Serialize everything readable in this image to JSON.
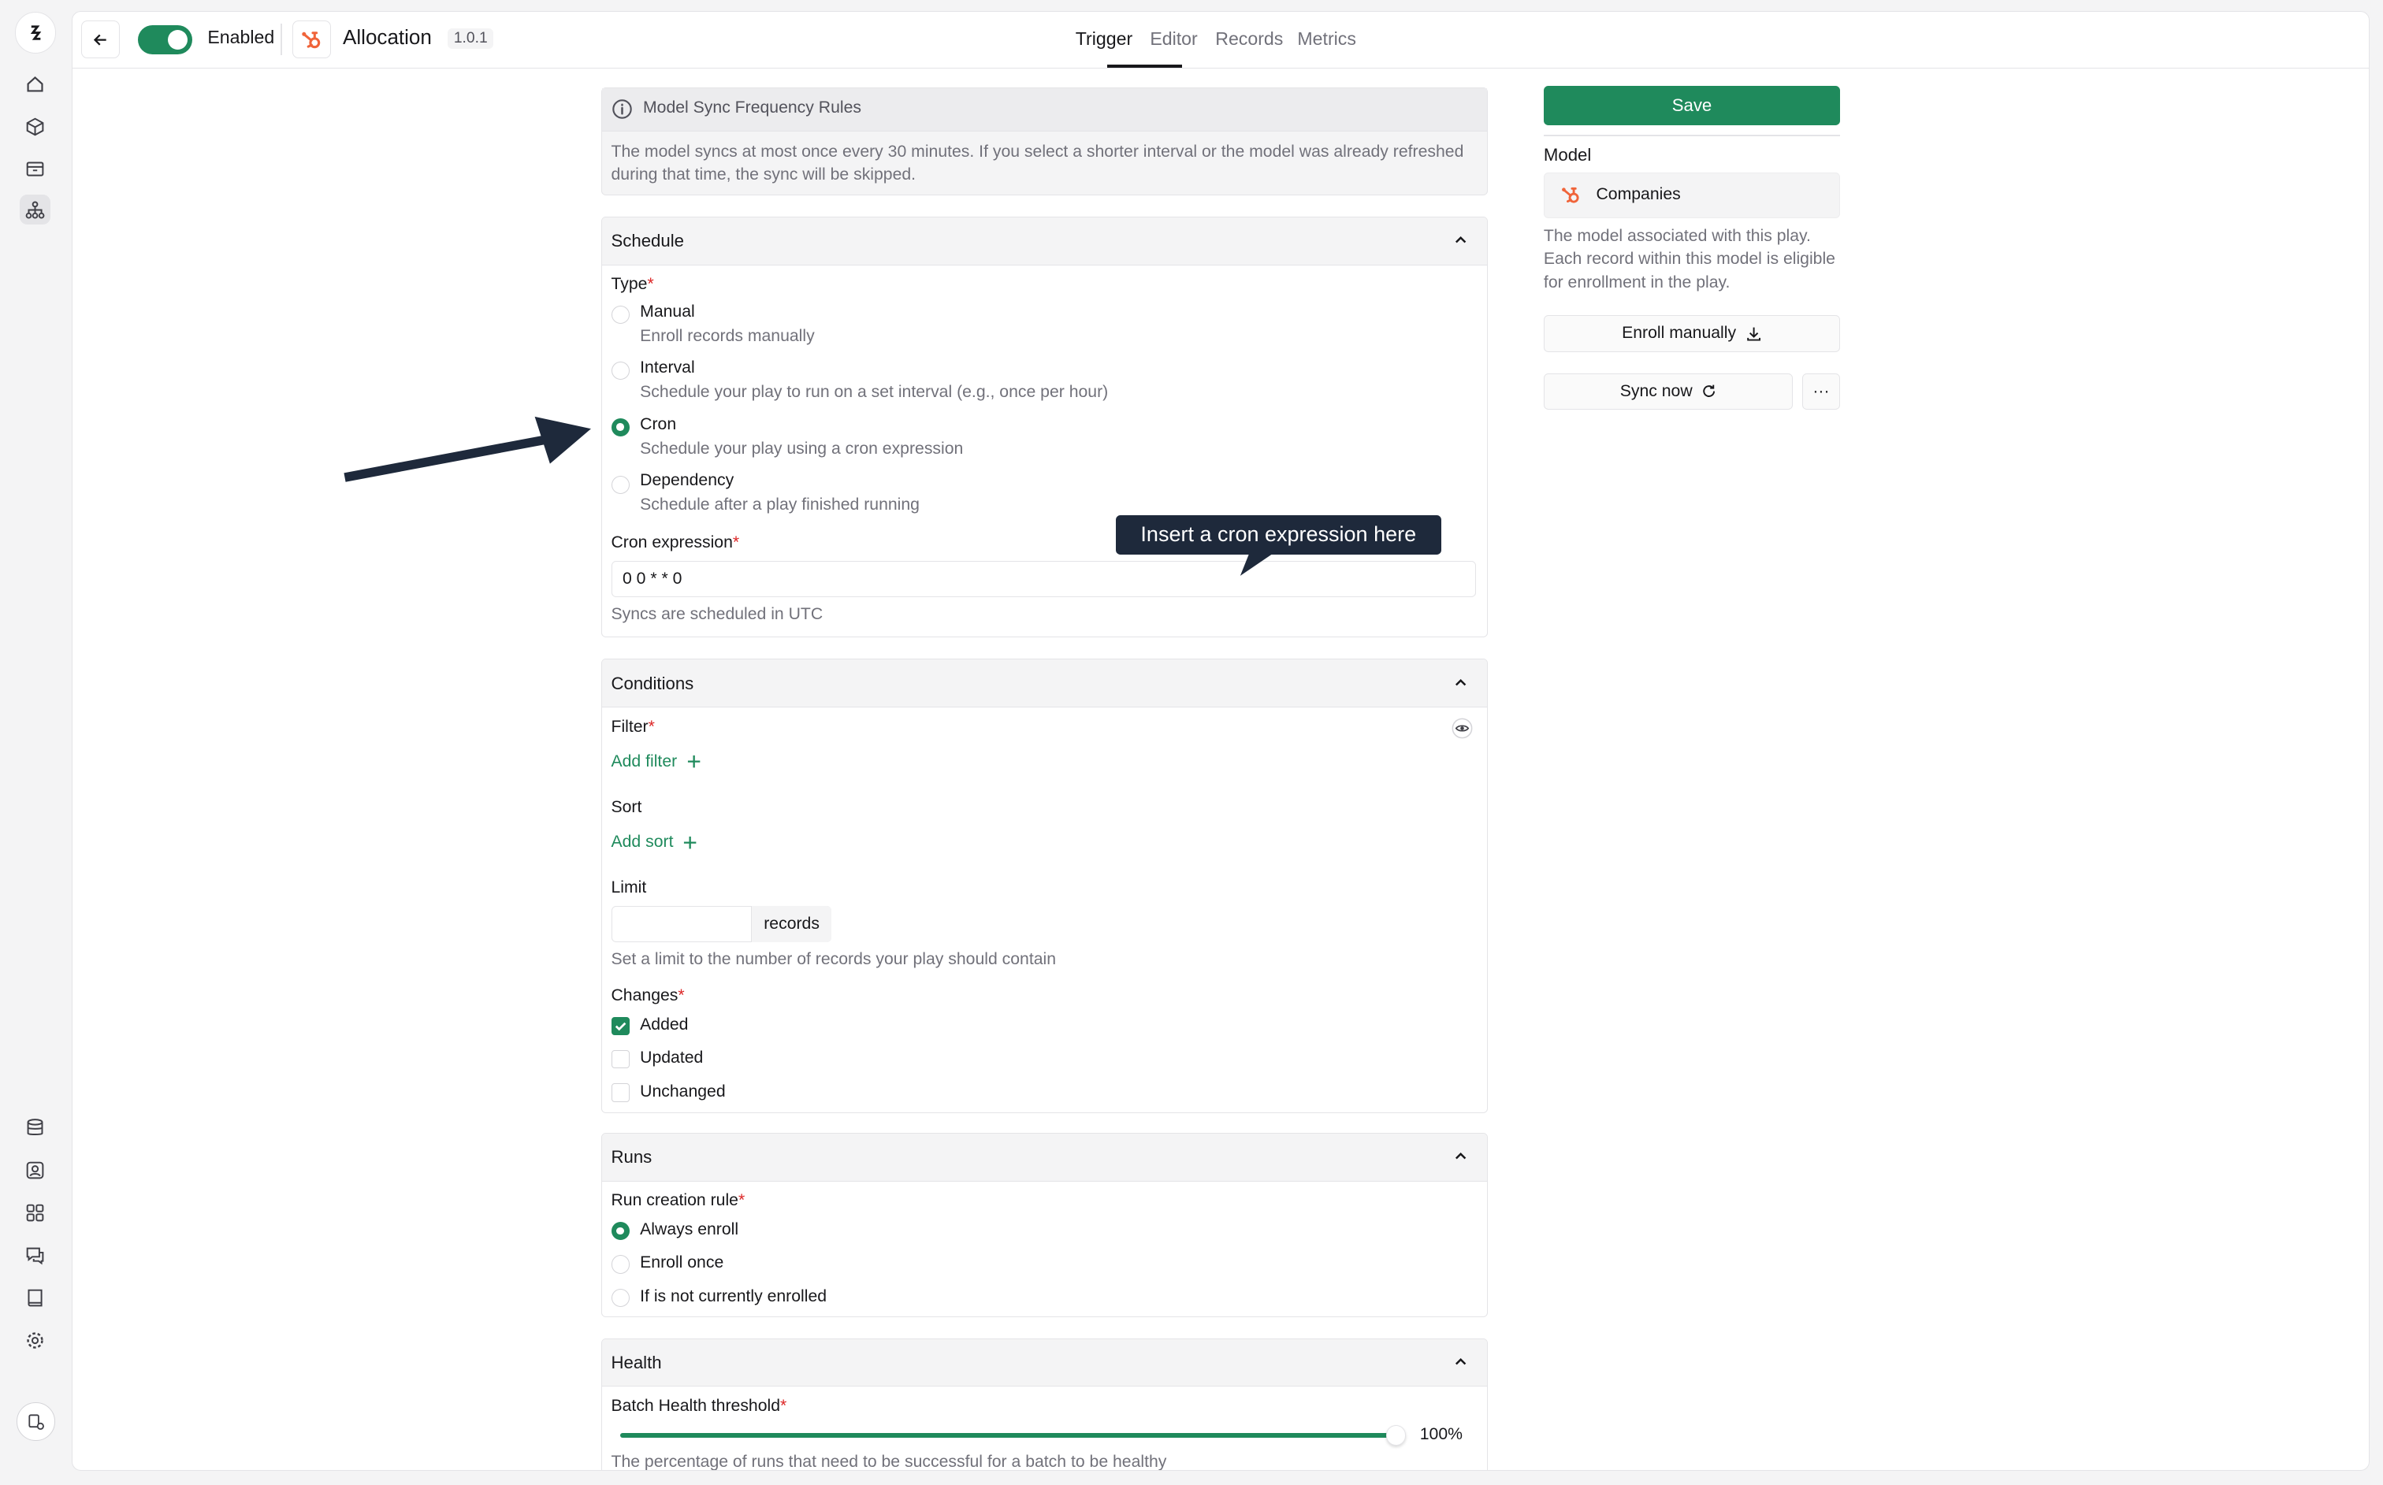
{
  "header": {
    "enabled_label": "Enabled",
    "title": "Allocation",
    "version": "1.0.1",
    "tabs": [
      {
        "label": "Trigger",
        "active": true
      },
      {
        "label": "Editor",
        "active": false
      },
      {
        "label": "Records",
        "active": false
      },
      {
        "label": "Metrics",
        "active": false
      }
    ]
  },
  "sidebar": {
    "top_icons": [
      "home-icon",
      "cube-icon",
      "inbox-icon",
      "hierarchy-icon"
    ],
    "bottom_icons": [
      "database-icon",
      "user-card-icon",
      "grid-icon",
      "chat-icon",
      "book-icon",
      "gear-icon"
    ]
  },
  "info": {
    "title": "Model Sync Frequency Rules",
    "text": "The model syncs at most once every 30 minutes. If you select a shorter interval or the model was already refreshed during that time, the sync will be skipped."
  },
  "schedule": {
    "title": "Schedule",
    "type_label": "Type",
    "options": [
      {
        "label": "Manual",
        "desc": "Enroll records manually",
        "selected": false
      },
      {
        "label": "Interval",
        "desc": "Schedule your play to run on a set interval (e.g., once per hour)",
        "selected": false
      },
      {
        "label": "Cron",
        "desc": "Schedule your play using a cron expression",
        "selected": true
      },
      {
        "label": "Dependency",
        "desc": "Schedule after a play finished running",
        "selected": false
      }
    ],
    "cron_label": "Cron expression",
    "cron_value": "0 0 * * 0",
    "cron_help": "Syncs are scheduled in UTC",
    "tooltip": "Insert a cron expression here"
  },
  "conditions": {
    "title": "Conditions",
    "filter_label": "Filter",
    "add_filter": "Add filter",
    "sort_label": "Sort",
    "add_sort": "Add sort",
    "limit_label": "Limit",
    "limit_value": "",
    "limit_unit": "records",
    "limit_help": "Set a limit to the number of records your play should contain",
    "changes_label": "Changes",
    "changes": [
      {
        "label": "Added",
        "checked": true
      },
      {
        "label": "Updated",
        "checked": false
      },
      {
        "label": "Unchanged",
        "checked": false
      }
    ]
  },
  "runs": {
    "title": "Runs",
    "rule_label": "Run creation rule",
    "options": [
      {
        "label": "Always enroll",
        "selected": true
      },
      {
        "label": "Enroll once",
        "selected": false
      },
      {
        "label": "If is not currently enrolled",
        "selected": false
      }
    ]
  },
  "health": {
    "title": "Health",
    "threshold_label": "Batch Health threshold",
    "threshold_value": 1.0,
    "threshold_text": "100%",
    "help": "The percentage of runs that need to be successful for a batch to be healthy"
  },
  "right_panel": {
    "save_label": "Save",
    "model_label": "Model",
    "model_name": "Companies",
    "model_desc": "The model associated with this play. Each record within this model is eligible for enrollment in the play.",
    "enroll_label": "Enroll manually",
    "sync_label": "Sync now",
    "more_label": "···"
  },
  "colors": {
    "accent": "#1f8a5c",
    "hubspot": "#f0643a",
    "tooltip_bg": "#1e293b",
    "required": "#dc2626"
  }
}
